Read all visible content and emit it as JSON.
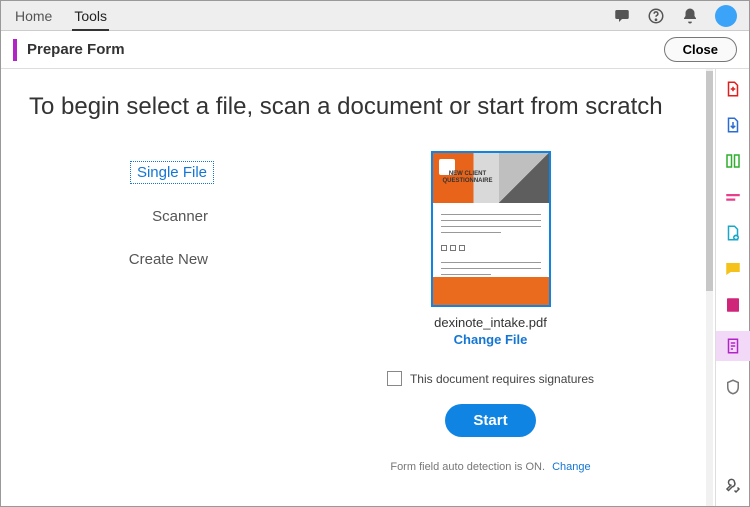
{
  "topbar": {
    "tabs": {
      "home": "Home",
      "tools": "Tools"
    }
  },
  "toolbar": {
    "title": "Prepare Form",
    "close": "Close"
  },
  "main": {
    "headline": "To begin select a file, scan a document or start from scratch",
    "options": {
      "single_file": "Single File",
      "scanner": "Scanner",
      "create_new": "Create New"
    },
    "thumb": {
      "title": "NEW CLIENT QUESTIONNAIRE"
    },
    "filename": "dexinote_intake.pdf",
    "change_file": "Change File",
    "signatures_label": "This document requires signatures",
    "start": "Start",
    "autodetect_text": "Form field auto detection is ON.",
    "autodetect_change": "Change"
  }
}
